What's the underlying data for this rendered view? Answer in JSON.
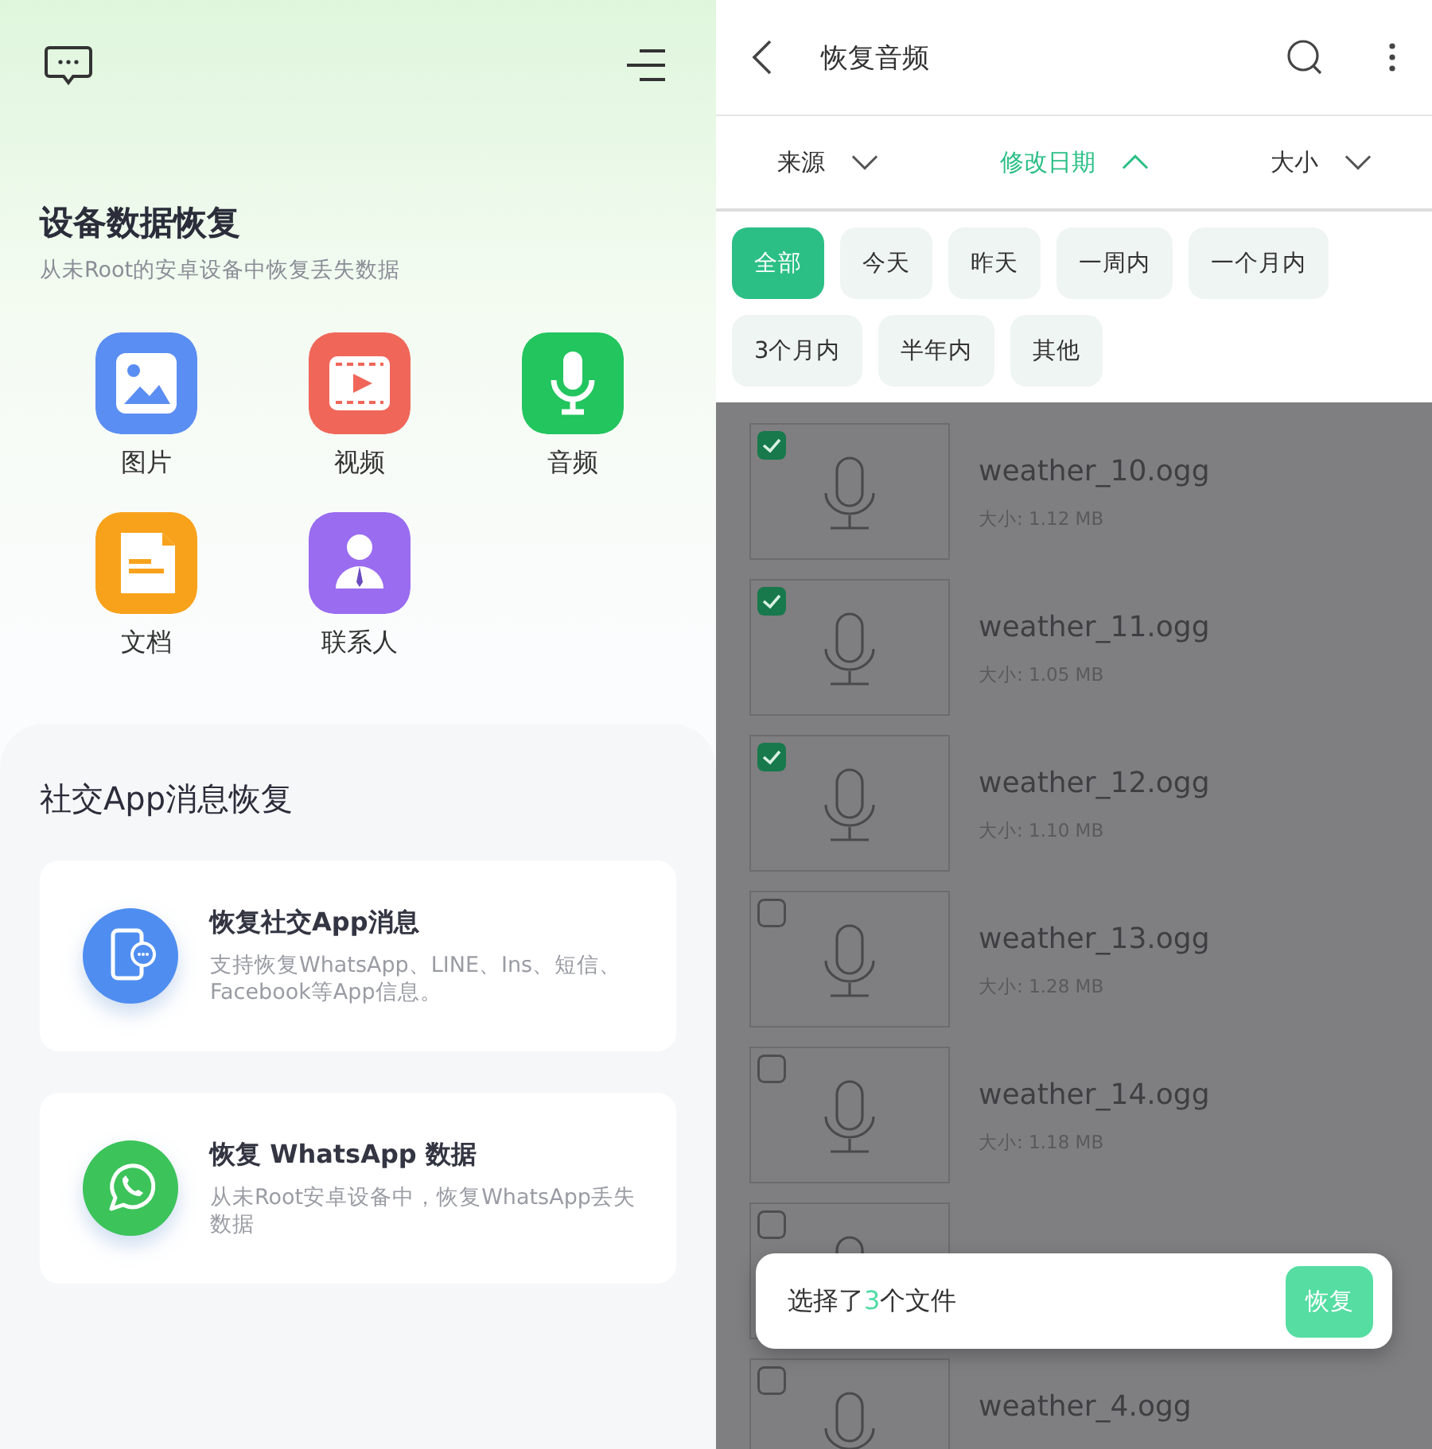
{
  "left": {
    "title": "设备数据恢复",
    "subtitle": "从未Root的安卓设备中恢复丢失数据",
    "categories": [
      {
        "kind": "image",
        "label": "图片",
        "color": "#5b8ef2"
      },
      {
        "kind": "video",
        "label": "视频",
        "color": "#f0675a"
      },
      {
        "kind": "audio",
        "label": "音频",
        "color": "#22c55e"
      },
      {
        "kind": "document",
        "label": "文档",
        "color": "#f8a21c"
      },
      {
        "kind": "contact",
        "label": "联系人",
        "color": "#9a6cf0"
      }
    ],
    "social": {
      "title": "社交App消息恢复",
      "cards": [
        {
          "kind": "social",
          "title": "恢复社交App消息",
          "description": "支持恢复WhatsApp、LINE、Ins、短信、Facebook等App信息。"
        },
        {
          "kind": "whatsapp",
          "title": "恢复 WhatsApp 数据",
          "description": "从未Root安卓设备中，恢复WhatsApp丢失数据"
        }
      ]
    }
  },
  "right": {
    "title": "恢复音频",
    "sort": [
      {
        "label": "来源",
        "selected": false
      },
      {
        "label": "修改日期",
        "selected": true
      },
      {
        "label": "大小",
        "selected": false
      }
    ],
    "filters": [
      {
        "label": "全部",
        "selected": true
      },
      {
        "label": "今天",
        "selected": false
      },
      {
        "label": "昨天",
        "selected": false
      },
      {
        "label": "一周内",
        "selected": false
      },
      {
        "label": "一个月内",
        "selected": false
      },
      {
        "label": "3个月内",
        "selected": false
      },
      {
        "label": "半年内",
        "selected": false
      },
      {
        "label": "其他",
        "selected": false
      }
    ],
    "files": [
      {
        "name": "weather_10.ogg",
        "size": "大小: 1.12 MB",
        "checked": true
      },
      {
        "name": "weather_11.ogg",
        "size": "大小: 1.05 MB",
        "checked": true
      },
      {
        "name": "weather_12.ogg",
        "size": "大小: 1.10 MB",
        "checked": true
      },
      {
        "name": "weather_13.ogg",
        "size": "大小: 1.28 MB",
        "checked": false
      },
      {
        "name": "weather_14.ogg",
        "size": "大小: 1.18 MB",
        "checked": false
      },
      {
        "checked": false
      },
      {
        "name": "weather_4.ogg",
        "checked": false
      }
    ],
    "toast": {
      "prefix": "选择了",
      "count": "3",
      "suffix": "个文件",
      "button": "恢复"
    }
  }
}
